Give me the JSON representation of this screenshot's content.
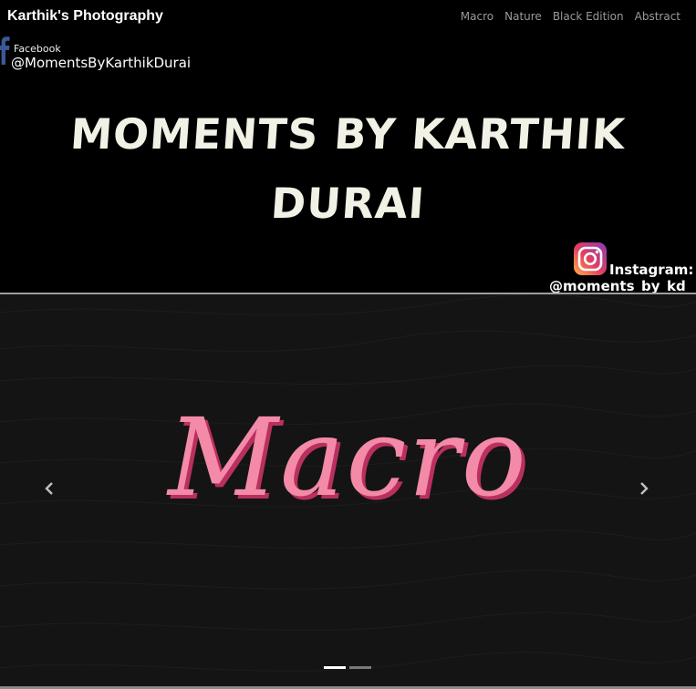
{
  "navbar": {
    "brand": "Karthik's Photography",
    "links": [
      "Macro",
      "Nature",
      "Black Edition",
      "Abstract"
    ]
  },
  "hero": {
    "facebook_label": "Facebook",
    "facebook_handle": "@MomentsByKarthikDurai",
    "title_line1": "MOMENTS BY KARTHIK",
    "title_line2": "DURAI",
    "instagram_label": "Instagram:",
    "instagram_handle": "@moments_by_kd"
  },
  "carousel": {
    "slide_title": "Macro",
    "prev_icon": "chevron-left-icon",
    "next_icon": "chevron-right-icon",
    "active_slide": 1,
    "slide_count": 2
  },
  "colors": {
    "accent_pink": "#f38aa8",
    "background": "#000000",
    "carousel_bg": "#141414"
  }
}
